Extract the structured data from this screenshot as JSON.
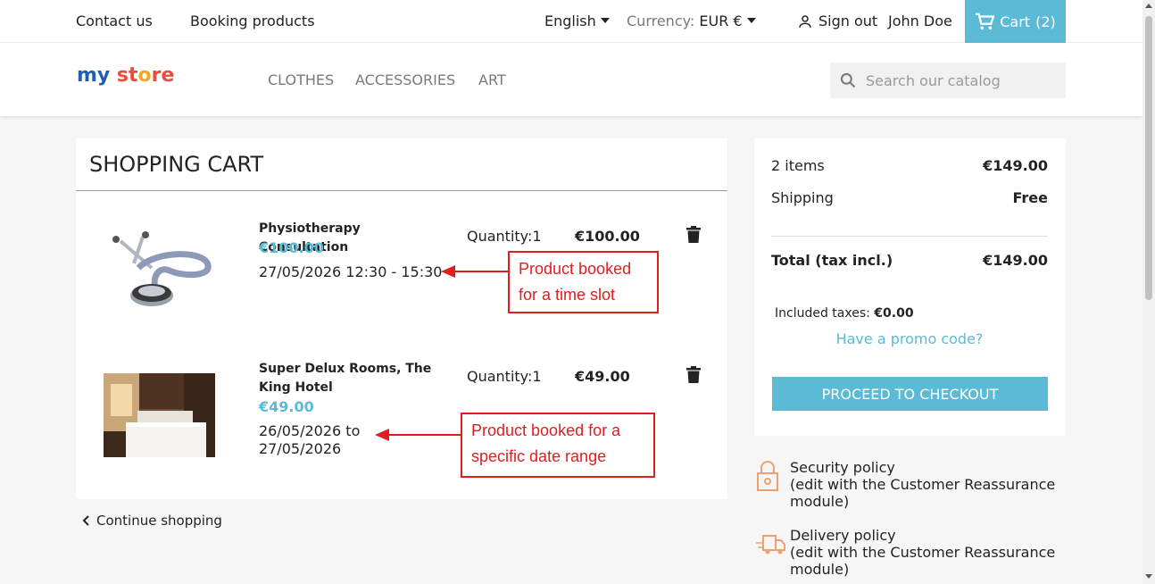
{
  "topbar": {
    "contact": "Contact us",
    "booking": "Booking products",
    "language": "English",
    "currency_label": "Currency:",
    "currency_value": "EUR €",
    "signout": "Sign out",
    "user": "John Doe",
    "cart": "Cart",
    "cart_count": "(2)"
  },
  "header": {
    "logo_parts": [
      "my",
      " st",
      "o",
      "re"
    ],
    "nav": [
      "CLOTHES",
      "ACCESSORIES",
      "ART"
    ],
    "search_placeholder": "Search our catalog"
  },
  "cart": {
    "title": "SHOPPING CART",
    "items": [
      {
        "name": "Physiotherapy Consultation",
        "price": "€100.00",
        "date": "27/05/2026 12:30 - 15:30",
        "quantity": "Quantity:1",
        "total": "€100.00",
        "image": "stethoscope"
      },
      {
        "name": "Super Delux Rooms, The King Hotel",
        "price": "€49.00",
        "date": "26/05/2026 to 27/05/2026",
        "quantity": "Quantity:1",
        "total": "€49.00",
        "image": "hotel-room"
      }
    ],
    "continue": "Continue shopping"
  },
  "annotations": {
    "slot": "Product booked for a time slot",
    "range": "Product booked for a specific date range"
  },
  "summary": {
    "items_label": "2 items",
    "items_value": "€149.00",
    "shipping_label": "Shipping",
    "shipping_value": "Free",
    "total_label": "Total (tax incl.)",
    "total_value": "€149.00",
    "taxes_label": "Included taxes:",
    "taxes_value": "€0.00",
    "promo": "Have a promo code?",
    "checkout": "PROCEED TO CHECKOUT"
  },
  "reassurance": [
    {
      "title": "Security policy",
      "desc": "(edit with the Customer Reassurance module)"
    },
    {
      "title": "Delivery policy",
      "desc": "(edit with the Customer Reassurance module)"
    }
  ],
  "colors": {
    "accent": "#5bbad5",
    "annotation": "#e01e1e"
  }
}
